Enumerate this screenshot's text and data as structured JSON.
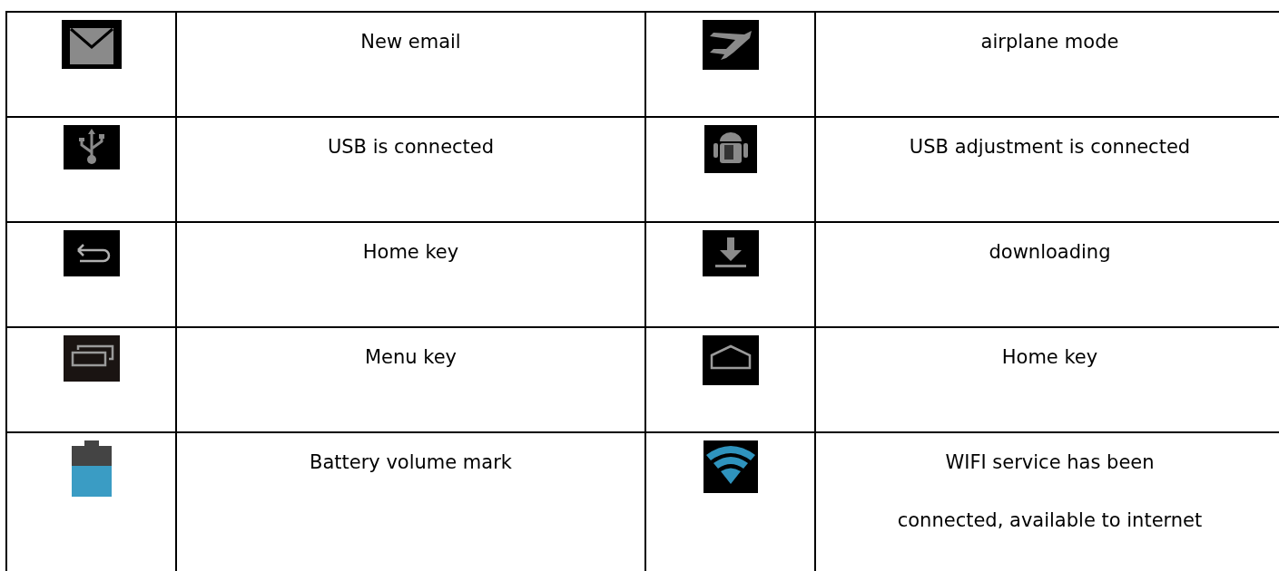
{
  "table": {
    "rows": [
      {
        "cells": [
          {
            "kind": "mail",
            "text": "New email"
          },
          {
            "kind": "airplane",
            "text": "airplane mode"
          }
        ]
      },
      {
        "cells": [
          {
            "kind": "usb",
            "text": "USB is connected"
          },
          {
            "kind": "android",
            "text": "USB adjustment is connected"
          }
        ]
      },
      {
        "cells": [
          {
            "kind": "back",
            "text": "Home key"
          },
          {
            "kind": "download",
            "text": "downloading"
          }
        ]
      },
      {
        "cells": [
          {
            "kind": "recent",
            "text": "Menu key"
          },
          {
            "kind": "home",
            "text": "Home key"
          }
        ]
      },
      {
        "cells": [
          {
            "kind": "battery",
            "text": "Battery volume mark"
          },
          {
            "kind": "wifi",
            "text": "WIFI service has been\nconnected, available to internet"
          }
        ]
      }
    ]
  }
}
